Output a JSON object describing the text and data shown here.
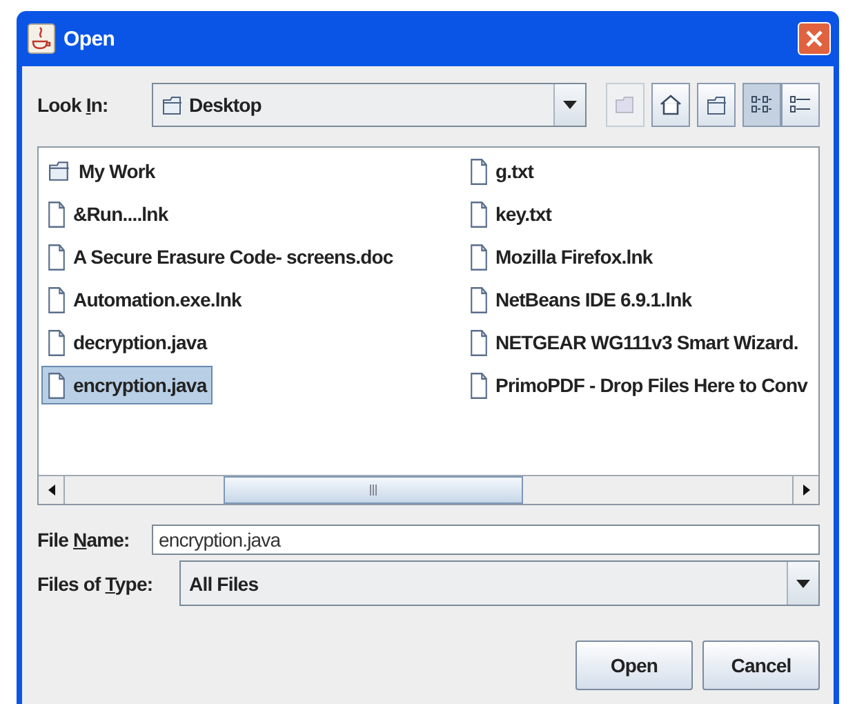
{
  "window": {
    "title": "Open"
  },
  "look_in": {
    "label_start": "Look ",
    "mnemonic": "I",
    "label_end": "n:",
    "value": "Desktop"
  },
  "toolbar": [
    {
      "kind": "up",
      "disabled": true,
      "selected": false
    },
    {
      "kind": "home",
      "disabled": false,
      "selected": false
    },
    {
      "kind": "new-folder",
      "disabled": false,
      "selected": false
    },
    {
      "kind": "list",
      "disabled": false,
      "selected": true
    },
    {
      "kind": "details",
      "disabled": false,
      "selected": false
    }
  ],
  "files": [
    {
      "name": "My Work",
      "kind": "folder",
      "selected": false
    },
    {
      "name": "&Run....lnk",
      "kind": "file",
      "selected": false
    },
    {
      "name": "A Secure Erasure Code- screens.doc",
      "kind": "file",
      "selected": false
    },
    {
      "name": "Automation.exe.lnk",
      "kind": "file",
      "selected": false
    },
    {
      "name": "decryption.java",
      "kind": "file",
      "selected": false
    },
    {
      "name": "encryption.java",
      "kind": "file",
      "selected": true
    },
    {
      "name": "g.txt",
      "kind": "file",
      "selected": false
    },
    {
      "name": "key.txt",
      "kind": "file",
      "selected": false
    },
    {
      "name": "Mozilla Firefox.lnk",
      "kind": "file",
      "selected": false
    },
    {
      "name": "NetBeans IDE 6.9.1.lnk",
      "kind": "file",
      "selected": false
    },
    {
      "name": "NETGEAR WG111v3 Smart Wizard.",
      "kind": "file",
      "selected": false
    },
    {
      "name": "PrimoPDF - Drop Files Here to Conv",
      "kind": "file",
      "selected": false
    }
  ],
  "file_name": {
    "label_start": "File ",
    "mnemonic": "N",
    "label_end": "ame:",
    "value": "encryption.java"
  },
  "file_type": {
    "label_start": "Files of ",
    "mnemonic": "T",
    "label_end": "ype:",
    "value": "All Files"
  },
  "buttons": [
    "Open",
    "Cancel"
  ]
}
